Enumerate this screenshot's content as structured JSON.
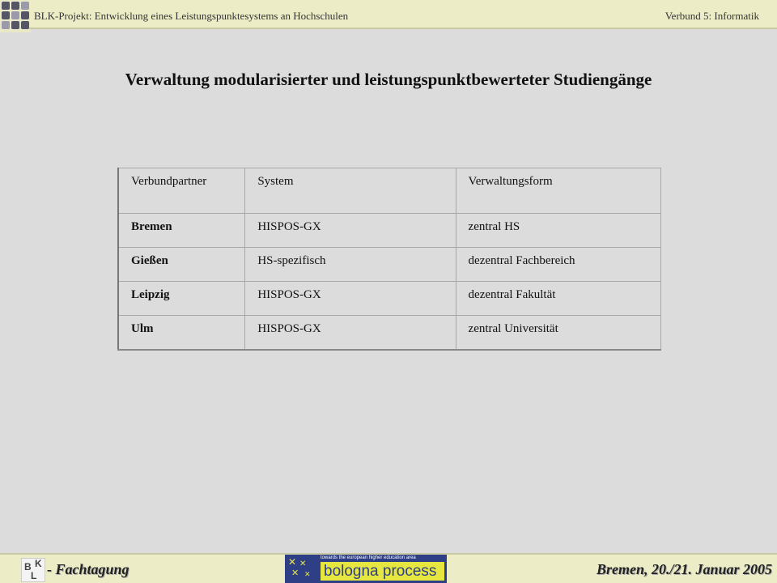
{
  "header": {
    "left_text": "BLK-Projekt: Entwicklung eines Leistungspunktesystems an Hochschulen",
    "right_text": "Verbund 5: Informatik",
    "logo_icon": "grid-squares-logo",
    "colors": {
      "band": "#ececc6",
      "grid_dark": "#555566",
      "grid_light": "#9a9aaa"
    }
  },
  "title": "Verwaltung modularisierter und leistungspunktbewerteter Studiengänge",
  "table": {
    "columns": [
      "Verbundpartner",
      "System",
      "Verwaltungsform"
    ],
    "rows": [
      {
        "partner": "Bremen",
        "system": "HISPOS-GX",
        "form": "zentral HS"
      },
      {
        "partner": "Gießen",
        "system": "HS-spezifisch",
        "form": "dezentral Fachbereich"
      },
      {
        "partner": "Leipzig",
        "system": "HISPOS-GX",
        "form": "dezentral Fakultät"
      },
      {
        "partner": "Ulm",
        "system": "HISPOS-GX",
        "form": "zentral Universität"
      }
    ]
  },
  "footer": {
    "blk_logo": {
      "b": "B",
      "k": "K",
      "l": "L"
    },
    "left_text": "- Fachtagung",
    "bologna": {
      "tagline": "towards the european higher education area",
      "brand": "bologna process",
      "colors": {
        "navy": "#2e3f86",
        "yellow": "#e6e640"
      }
    },
    "right_text": "Bremen, 20./21. Januar 2005"
  }
}
